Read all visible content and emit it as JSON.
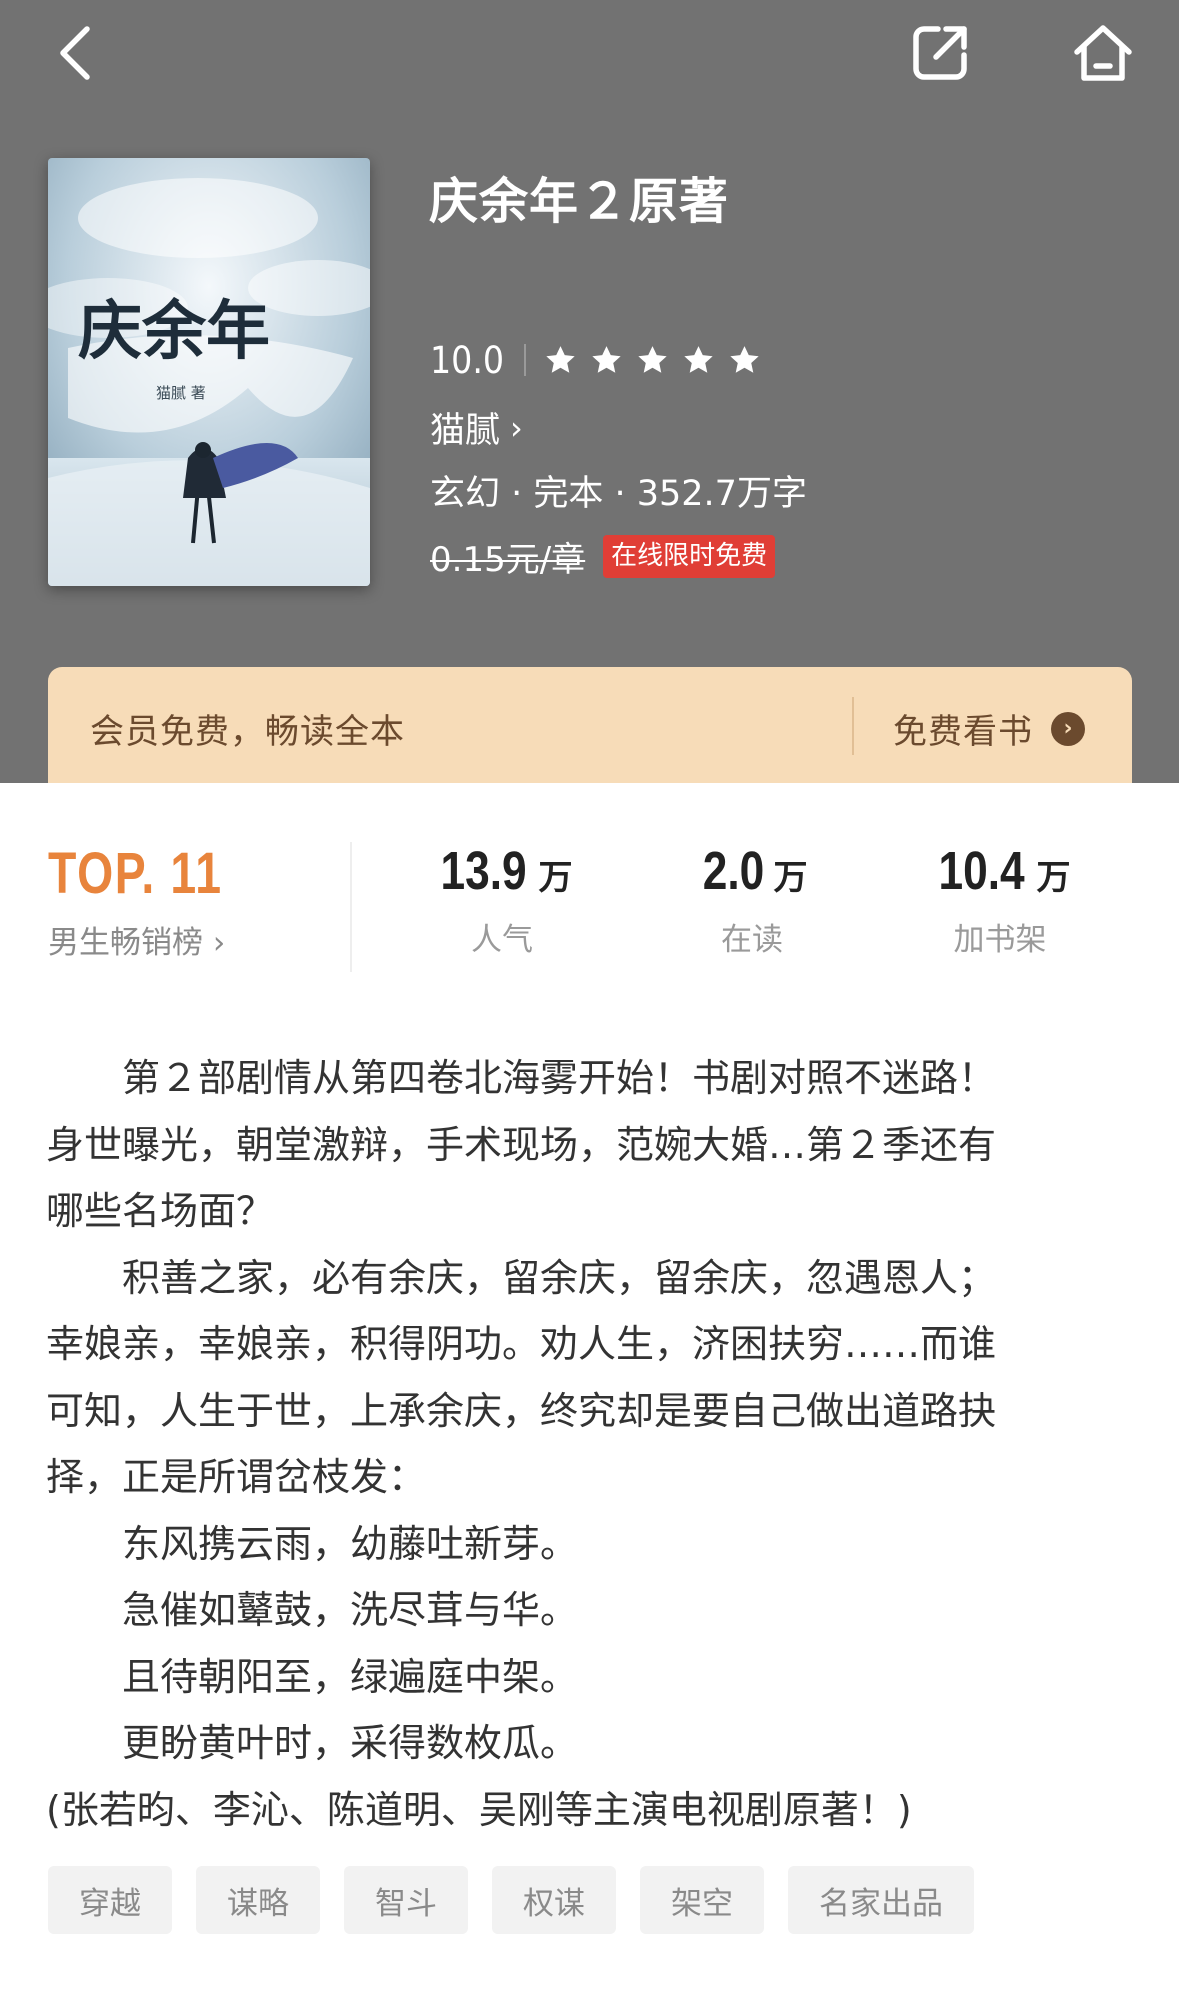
{
  "nav": {
    "back_icon": "chevron-left-icon",
    "share_icon": "share-icon",
    "home_icon": "home-icon"
  },
  "book": {
    "title": "庆余年２原著",
    "score": "10.0",
    "star_rating": 5,
    "author": "猫腻",
    "meta": "玄幻 · 完本 · 352.7万字",
    "price": "0.15元/章",
    "free_badge": "在线限时免费",
    "cover_title": "庆余年",
    "cover_author": "猫腻 著"
  },
  "vip": {
    "text": "会员免费，畅读全本",
    "cta": "免费看书",
    "cta_icon": "chevron-right-circle-icon"
  },
  "stats": {
    "rank": {
      "top": "TOP. 11",
      "label": "男生畅销榜 ›"
    },
    "items": [
      {
        "value": "13.9",
        "unit": "万",
        "label": "人气"
      },
      {
        "value": "2.0",
        "unit": "万",
        "label": "在读"
      },
      {
        "value": "10.4",
        "unit": "万",
        "label": "加书架"
      }
    ]
  },
  "description": [
    "　　第２部剧情从第四卷北海雾开始！书剧对照不迷路！",
    "身世曝光，朝堂激辩，手术现场，范婉大婚…第２季还有",
    "哪些名场面？",
    "　　积善之家，必有余庆，留余庆，留余庆，忽遇恩人；",
    "幸娘亲，幸娘亲，积得阴功。劝人生，济困扶穷……而谁",
    "可知，人生于世，上承余庆，终究却是要自己做出道路抉",
    "择，正是所谓岔枝发：",
    "　　东风携云雨，幼藤吐新芽。",
    "　　急催如鼙鼓，洗尽茸与华。",
    "　　且待朝阳至，绿遍庭中架。",
    "　　更盼黄叶时，采得数枚瓜。",
    "(张若昀、李沁、陈道明、吴刚等主演电视剧原著！)"
  ],
  "tags": [
    "穿越",
    "谋略",
    "智斗",
    "权谋",
    "架空",
    "名家出品"
  ],
  "colors": {
    "header_bg": "#727272",
    "vip_bg": "#f7dcb8",
    "vip_text": "#6b4a2e",
    "rank_orange": "#e8843c",
    "badge_red": "#e03e36"
  }
}
